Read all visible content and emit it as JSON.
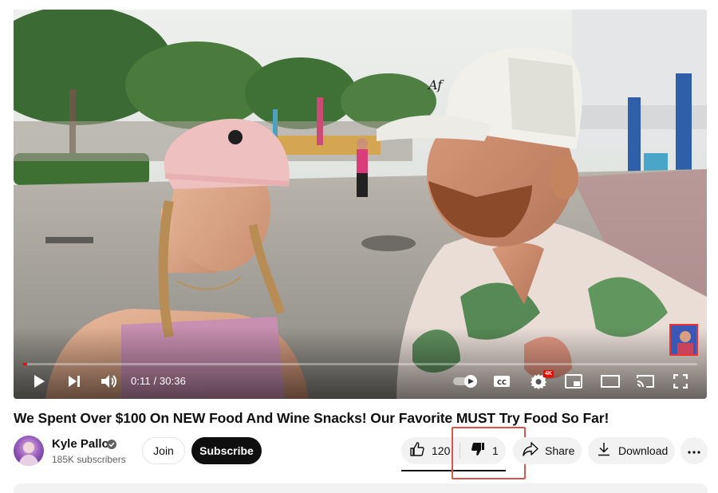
{
  "player": {
    "current_time": "0:11",
    "duration": "30:36",
    "time_display": "0:11 / 30:36",
    "progress_fraction": 0.006,
    "quality_badge": "4K",
    "accent_color": "#ff0000"
  },
  "icons": {
    "play": "play-icon",
    "next": "next-icon",
    "volume": "volume-icon",
    "autoplay": "autoplay-toggle-icon",
    "captions": "cc-icon",
    "settings": "gear-icon",
    "miniplayer": "miniplayer-icon",
    "theater": "theater-icon",
    "cast": "cast-icon",
    "fullscreen": "fullscreen-icon",
    "verified": "verified-icon",
    "like": "thumb-up-icon",
    "dislike": "thumb-down-icon",
    "share": "share-icon",
    "download": "download-icon",
    "more": "more-icon"
  },
  "video": {
    "title": "We Spent Over $100 On NEW Food And Wine Snacks! Our Favorite MUST Try Food So Far!"
  },
  "channel": {
    "name": "Kyle Pallo",
    "subscribers": "185K subscribers",
    "join_label": "Join",
    "subscribe_label": "Subscribe"
  },
  "actions": {
    "like_count": "120",
    "dislike_count": "1",
    "share_label": "Share",
    "download_label": "Download"
  },
  "colors": {
    "subscribe_bg": "#0f0f0f",
    "pill_bg": "#f2f2f2",
    "highlight_border": "#d9534f"
  }
}
